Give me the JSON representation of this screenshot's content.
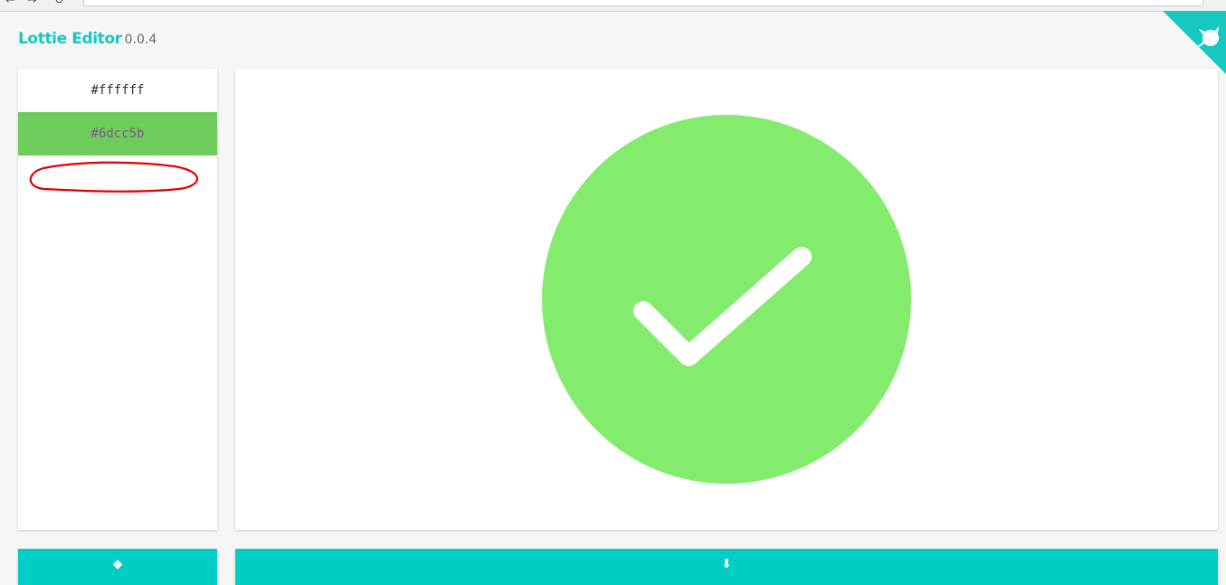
{
  "browser": {
    "back_icon": "arrow-left-icon",
    "forward_icon": "arrow-right-icon",
    "reload_icon": "reload-icon"
  },
  "header": {
    "title": "Lottie Editor",
    "version": "0.0.4"
  },
  "colors": {
    "items": [
      {
        "label": "#ffffff"
      },
      {
        "label": "#6dcc5b"
      }
    ],
    "selected_index": 1,
    "accent": "#16c8c0",
    "selected_bg": "#6dcc5b",
    "annotation_color": "#e00000"
  },
  "preview": {
    "circle_color": "#84ec6d",
    "check_color": "#ffffff",
    "icon": "checkmark-circle-icon"
  },
  "actions": {
    "left_icon": "layers-icon",
    "right_icon": "download-icon",
    "bar_color": "#00cdc3"
  },
  "github_corner": {
    "color": "#16c8c0",
    "icon": "octocat-icon"
  }
}
